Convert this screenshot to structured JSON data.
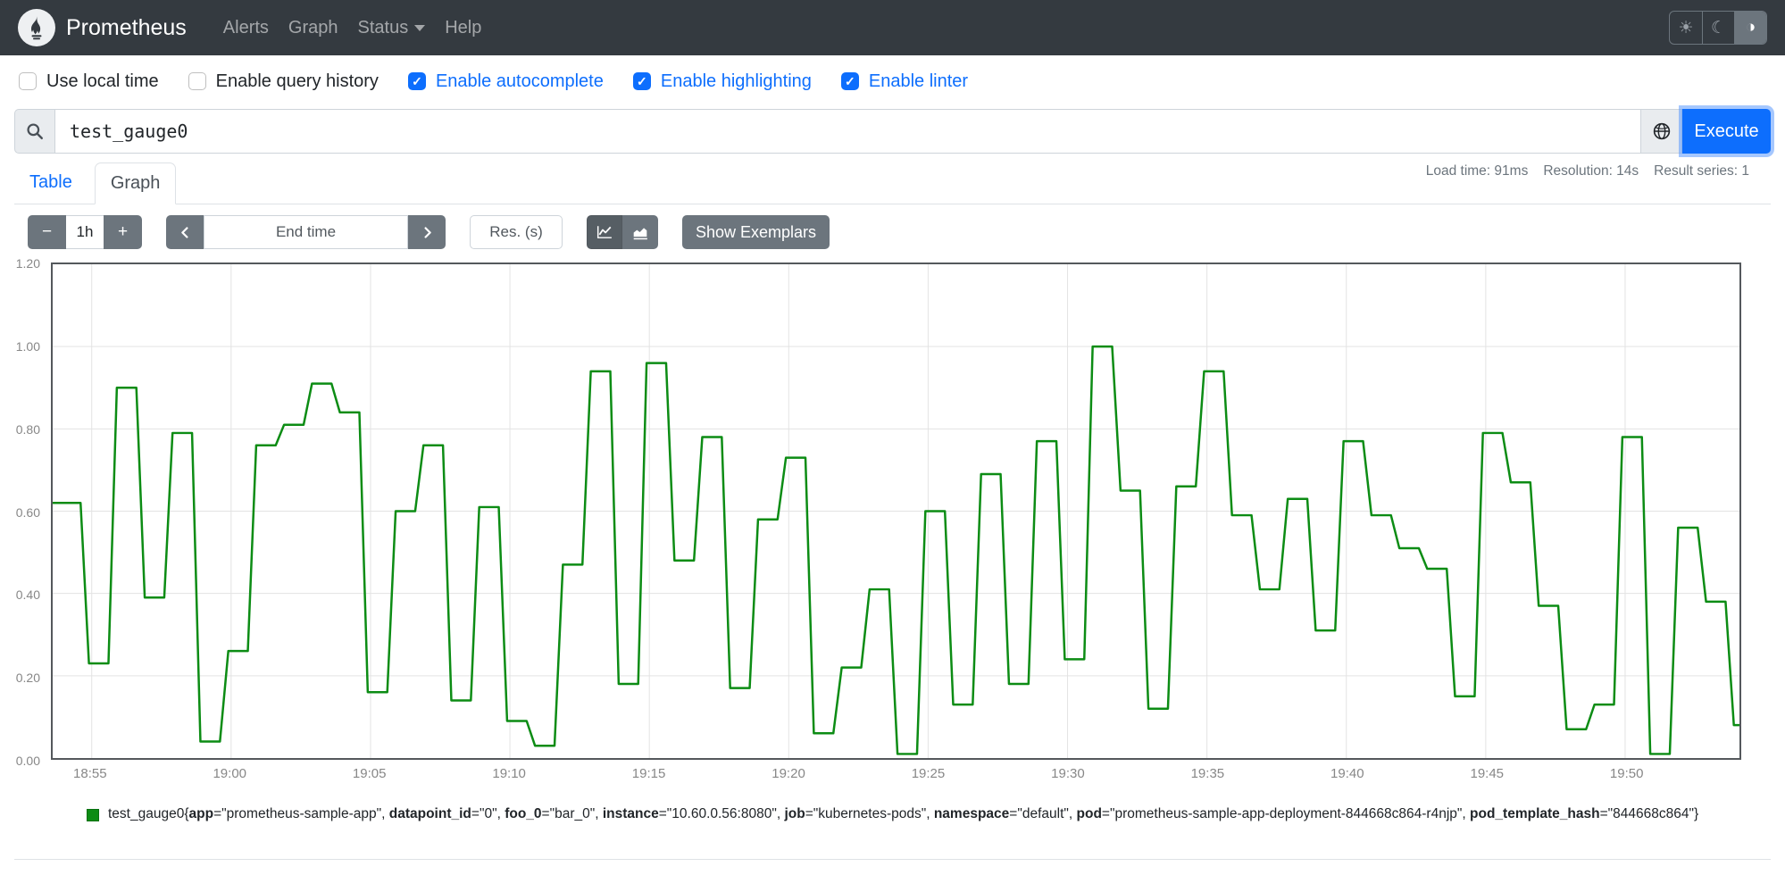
{
  "navbar": {
    "brand": "Prometheus",
    "items": [
      {
        "label": "Alerts"
      },
      {
        "label": "Graph"
      },
      {
        "label": "Status",
        "has_caret": true
      },
      {
        "label": "Help"
      }
    ],
    "theme_toggle": {
      "light_icon": "☀",
      "dark_icon": "☾",
      "auto_icon": "◑",
      "active": "auto"
    }
  },
  "options": [
    {
      "label": "Use local time",
      "checked": false
    },
    {
      "label": "Enable query history",
      "checked": false
    },
    {
      "label": "Enable autocomplete",
      "checked": true
    },
    {
      "label": "Enable highlighting",
      "checked": true
    },
    {
      "label": "Enable linter",
      "checked": true
    }
  ],
  "query": {
    "value": "test_gauge0",
    "execute_label": "Execute"
  },
  "stats": {
    "load_time": "Load time: 91ms",
    "resolution": "Resolution: 14s",
    "result_series": "Result series: 1"
  },
  "tabs": [
    {
      "label": "Table",
      "active": false
    },
    {
      "label": "Graph",
      "active": true
    }
  ],
  "controls": {
    "zoom_out": "−",
    "range_value": "1h",
    "zoom_in": "+",
    "end_time_placeholder": "End time",
    "res_placeholder": "Res. (s)",
    "show_exemplars": "Show Exemplars"
  },
  "chart_data": {
    "type": "line",
    "title": "",
    "xlabel": "",
    "ylabel": "",
    "ylim": [
      0,
      1.2
    ],
    "grid": true,
    "legend_position": "bottom",
    "series_color": "#0c8c14",
    "y_ticks": [
      "0.00",
      "0.20",
      "0.40",
      "0.60",
      "0.80",
      "1.00",
      "1.20"
    ],
    "x_ticks": [
      "18:55",
      "19:00",
      "19:05",
      "19:10",
      "19:15",
      "19:20",
      "19:25",
      "19:30",
      "19:35",
      "19:40",
      "19:45",
      "19:50"
    ],
    "x_span_minutes": 60.5,
    "first_tick_offset_minutes": 1.4,
    "tick_interval_minutes": 5,
    "step_minutes": 1,
    "transition_minutes": 0.3,
    "series": [
      {
        "name": "test_gauge0",
        "values": [
          0.62,
          0.23,
          0.9,
          0.39,
          0.79,
          0.04,
          0.26,
          0.76,
          0.81,
          0.91,
          0.84,
          0.16,
          0.6,
          0.76,
          0.14,
          0.61,
          0.09,
          0.03,
          0.47,
          0.94,
          0.18,
          0.96,
          0.48,
          0.78,
          0.17,
          0.58,
          0.73,
          0.06,
          0.22,
          0.41,
          0.01,
          0.6,
          0.13,
          0.69,
          0.18,
          0.77,
          0.24,
          1.0,
          0.65,
          0.12,
          0.66,
          0.94,
          0.59,
          0.41,
          0.63,
          0.31,
          0.77,
          0.59,
          0.51,
          0.46,
          0.15,
          0.79,
          0.67,
          0.37,
          0.07,
          0.13,
          0.78,
          0.01,
          0.56,
          0.38,
          0.08
        ]
      }
    ]
  },
  "legend": {
    "metric": "test_gauge0",
    "labels": [
      {
        "k": "app",
        "v": "prometheus-sample-app"
      },
      {
        "k": "datapoint_id",
        "v": "0"
      },
      {
        "k": "foo_0",
        "v": "bar_0"
      },
      {
        "k": "instance",
        "v": "10.60.0.56:8080"
      },
      {
        "k": "job",
        "v": "kubernetes-pods"
      },
      {
        "k": "namespace",
        "v": "default"
      },
      {
        "k": "pod",
        "v": "prometheus-sample-app-deployment-844668c864-r4njp"
      },
      {
        "k": "pod_template_hash",
        "v": "844668c864"
      }
    ]
  }
}
